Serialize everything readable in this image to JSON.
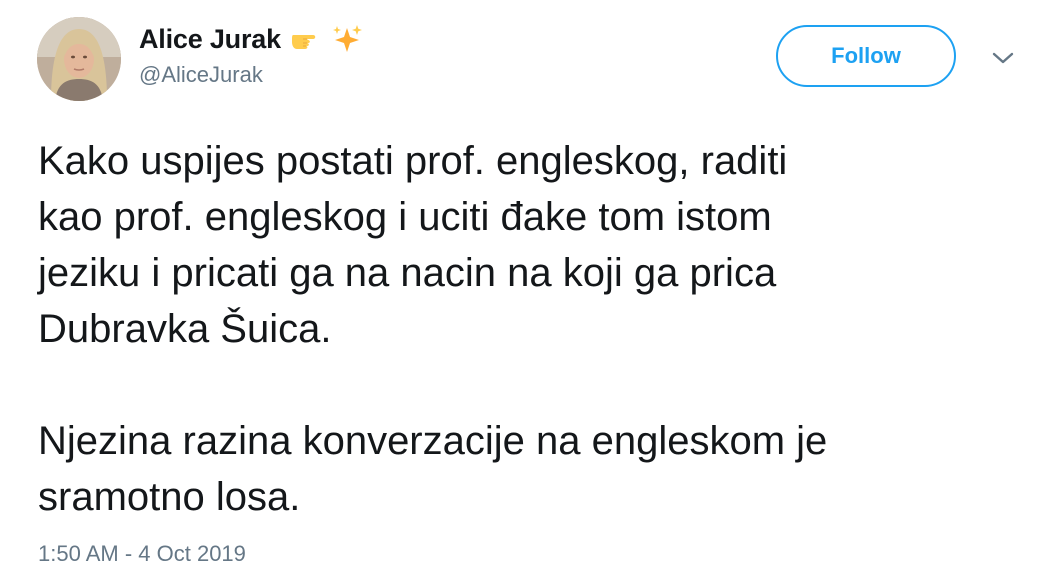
{
  "user": {
    "display_name": "Alice Jurak",
    "handle": "@AliceJurak",
    "name_emojis": [
      "pointing-hand-icon",
      "sparkles-icon"
    ]
  },
  "actions": {
    "follow_label": "Follow",
    "more_icon": "chevron-down-icon"
  },
  "tweet": {
    "paragraphs": [
      [
        "Kako uspijes postati prof. engleskog, raditi",
        "kao prof. engleskog i uciti đake tom istom",
        "jeziku i pricati ga na nacin na koji ga prica",
        "Dubravka Šuica."
      ],
      [
        "Njezina razina konverzacije na engleskom je",
        "sramotno losa."
      ]
    ],
    "timestamp": "1:50 AM - 4 Oct 2019"
  },
  "colors": {
    "accent": "#1da1f2",
    "text": "#14171a",
    "secondary": "#657786"
  }
}
